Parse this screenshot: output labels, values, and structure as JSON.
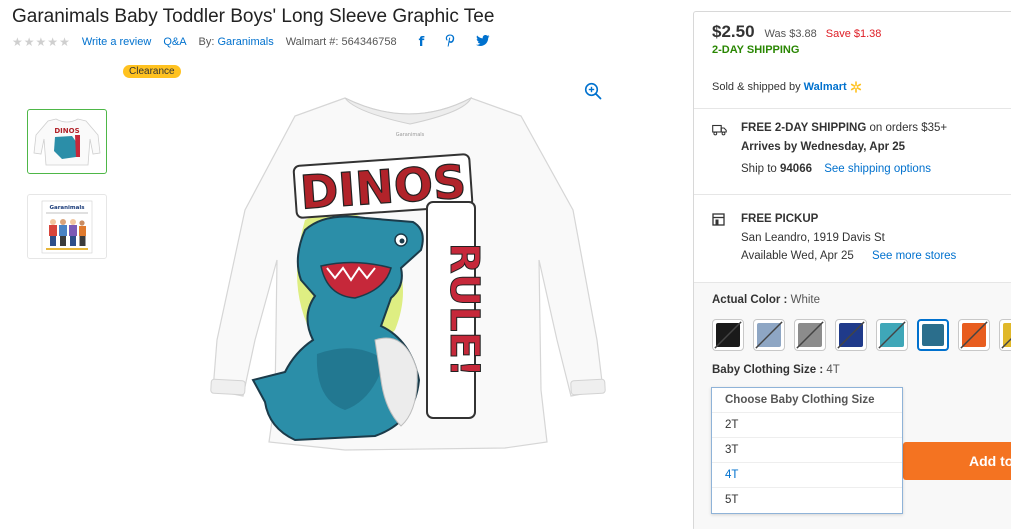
{
  "product": {
    "title": "Garanimals Baby Toddler Boys' Long Sleeve Graphic Tee",
    "write_review": "Write a review",
    "qa": "Q&A",
    "by_label": "By:",
    "brand": "Garanimals",
    "walmart_number": "Walmart #: 564346758",
    "clearance_badge": "Clearance",
    "shirt_art": {
      "brand_tag": "Garanimals",
      "headline": "DINOS",
      "sub": "RULE!"
    },
    "thumb2_text": "Garanimals"
  },
  "pricing": {
    "price": "$2.50",
    "was": "Was $3.88",
    "save": "Save $1.38",
    "two_day": "2-DAY SHIPPING",
    "sold_by": "Sold & shipped by",
    "seller": "Walmart"
  },
  "shipping": {
    "free_label": "FREE 2-DAY SHIPPING",
    "free_suffix": "on orders $35+",
    "arrives": "Arrives by Wednesday, Apr 25",
    "ship_to_label": "Ship to",
    "zip": "94066",
    "options_link": "See shipping options"
  },
  "pickup": {
    "label": "FREE PICKUP",
    "store": "San Leandro, 1919 Davis St",
    "available": "Available Wed, Apr 25",
    "more_link": "See more stores"
  },
  "variants": {
    "color_label": "Actual Color :",
    "color_value": "White",
    "size_label": "Baby Clothing Size :",
    "size_value": "4T",
    "swatches": [
      {
        "name": "black",
        "color": "#1a1a1a",
        "unavailable": true,
        "selected": false
      },
      {
        "name": "light-blue-heather",
        "color": "#8ea6c4",
        "unavailable": true,
        "selected": false
      },
      {
        "name": "gray-heather",
        "color": "#8c8c8c",
        "unavailable": true,
        "selected": false
      },
      {
        "name": "navy",
        "color": "#1f3a8a",
        "unavailable": true,
        "selected": false
      },
      {
        "name": "aqua",
        "color": "#3fa7b8",
        "unavailable": true,
        "selected": false
      },
      {
        "name": "white-dino",
        "color": "#2b6e8c",
        "unavailable": false,
        "selected": true
      },
      {
        "name": "orange",
        "color": "#e85d1f",
        "unavailable": true,
        "selected": false
      },
      {
        "name": "yellow",
        "color": "#e0b82a",
        "unavailable": true,
        "selected": false
      }
    ]
  },
  "size_dropdown": {
    "header": "Choose Baby Clothing Size",
    "options": [
      "2T",
      "3T",
      "4T",
      "5T"
    ],
    "selected": "4T"
  },
  "cta": {
    "add_label": "Add to Cart"
  },
  "colors": {
    "accent": "#0071ce",
    "save_red": "#de1c24",
    "shipping_green": "#2a8703",
    "clearance_yellow": "#ffc220",
    "cta_orange": "#f47321"
  }
}
